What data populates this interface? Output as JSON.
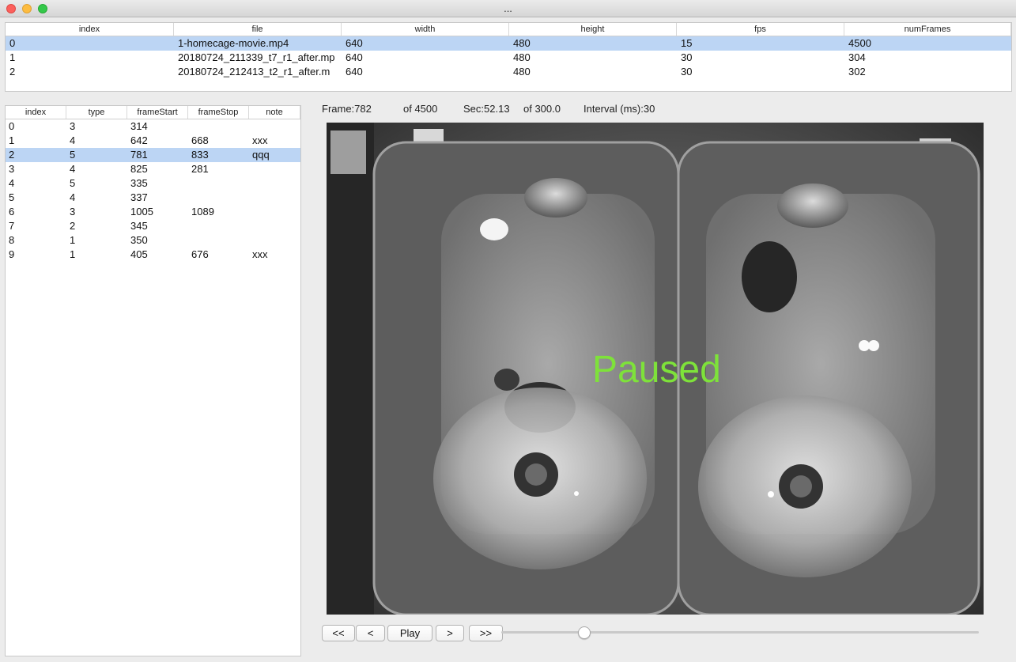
{
  "window": {
    "title": "..."
  },
  "files_table": {
    "columns": [
      "index",
      "file",
      "width",
      "height",
      "fps",
      "numFrames"
    ],
    "rows": [
      [
        "0",
        "1-homecage-movie.mp4",
        "640",
        "480",
        "15",
        "4500"
      ],
      [
        "1",
        "20180724_211339_t7_r1_after.mp",
        "640",
        "480",
        "30",
        "304"
      ],
      [
        "2",
        "20180724_212413_t2_r1_after.m",
        "640",
        "480",
        "30",
        "302"
      ]
    ],
    "selected_row": 0
  },
  "events_table": {
    "columns": [
      "index",
      "type",
      "frameStart",
      "frameStop",
      "note"
    ],
    "rows": [
      [
        "0",
        "3",
        "314",
        "",
        ""
      ],
      [
        "1",
        "4",
        "642",
        "668",
        "xxx"
      ],
      [
        "2",
        "5",
        "781",
        "833",
        "qqq"
      ],
      [
        "3",
        "4",
        "825",
        "281",
        ""
      ],
      [
        "4",
        "5",
        "335",
        "",
        ""
      ],
      [
        "5",
        "4",
        "337",
        "",
        ""
      ],
      [
        "6",
        "3",
        "1005",
        "1089",
        ""
      ],
      [
        "7",
        "2",
        "345",
        "",
        ""
      ],
      [
        "8",
        "1",
        "350",
        "",
        ""
      ],
      [
        "9",
        "1",
        "405",
        "676",
        "xxx"
      ]
    ],
    "selected_row": 2
  },
  "info": {
    "frame": "Frame:782",
    "of_frames": "of 4500",
    "sec": "Sec:52.13",
    "of_sec": "of 300.0",
    "interval": "Interval (ms):30"
  },
  "video": {
    "overlay_text": "Paused",
    "overlay_color": "#7ee23a"
  },
  "controls": {
    "first_label": "<<",
    "prev_label": "<",
    "play_label": "Play",
    "next_label": ">",
    "last_label": ">>",
    "slider_fraction": 0.1738
  }
}
